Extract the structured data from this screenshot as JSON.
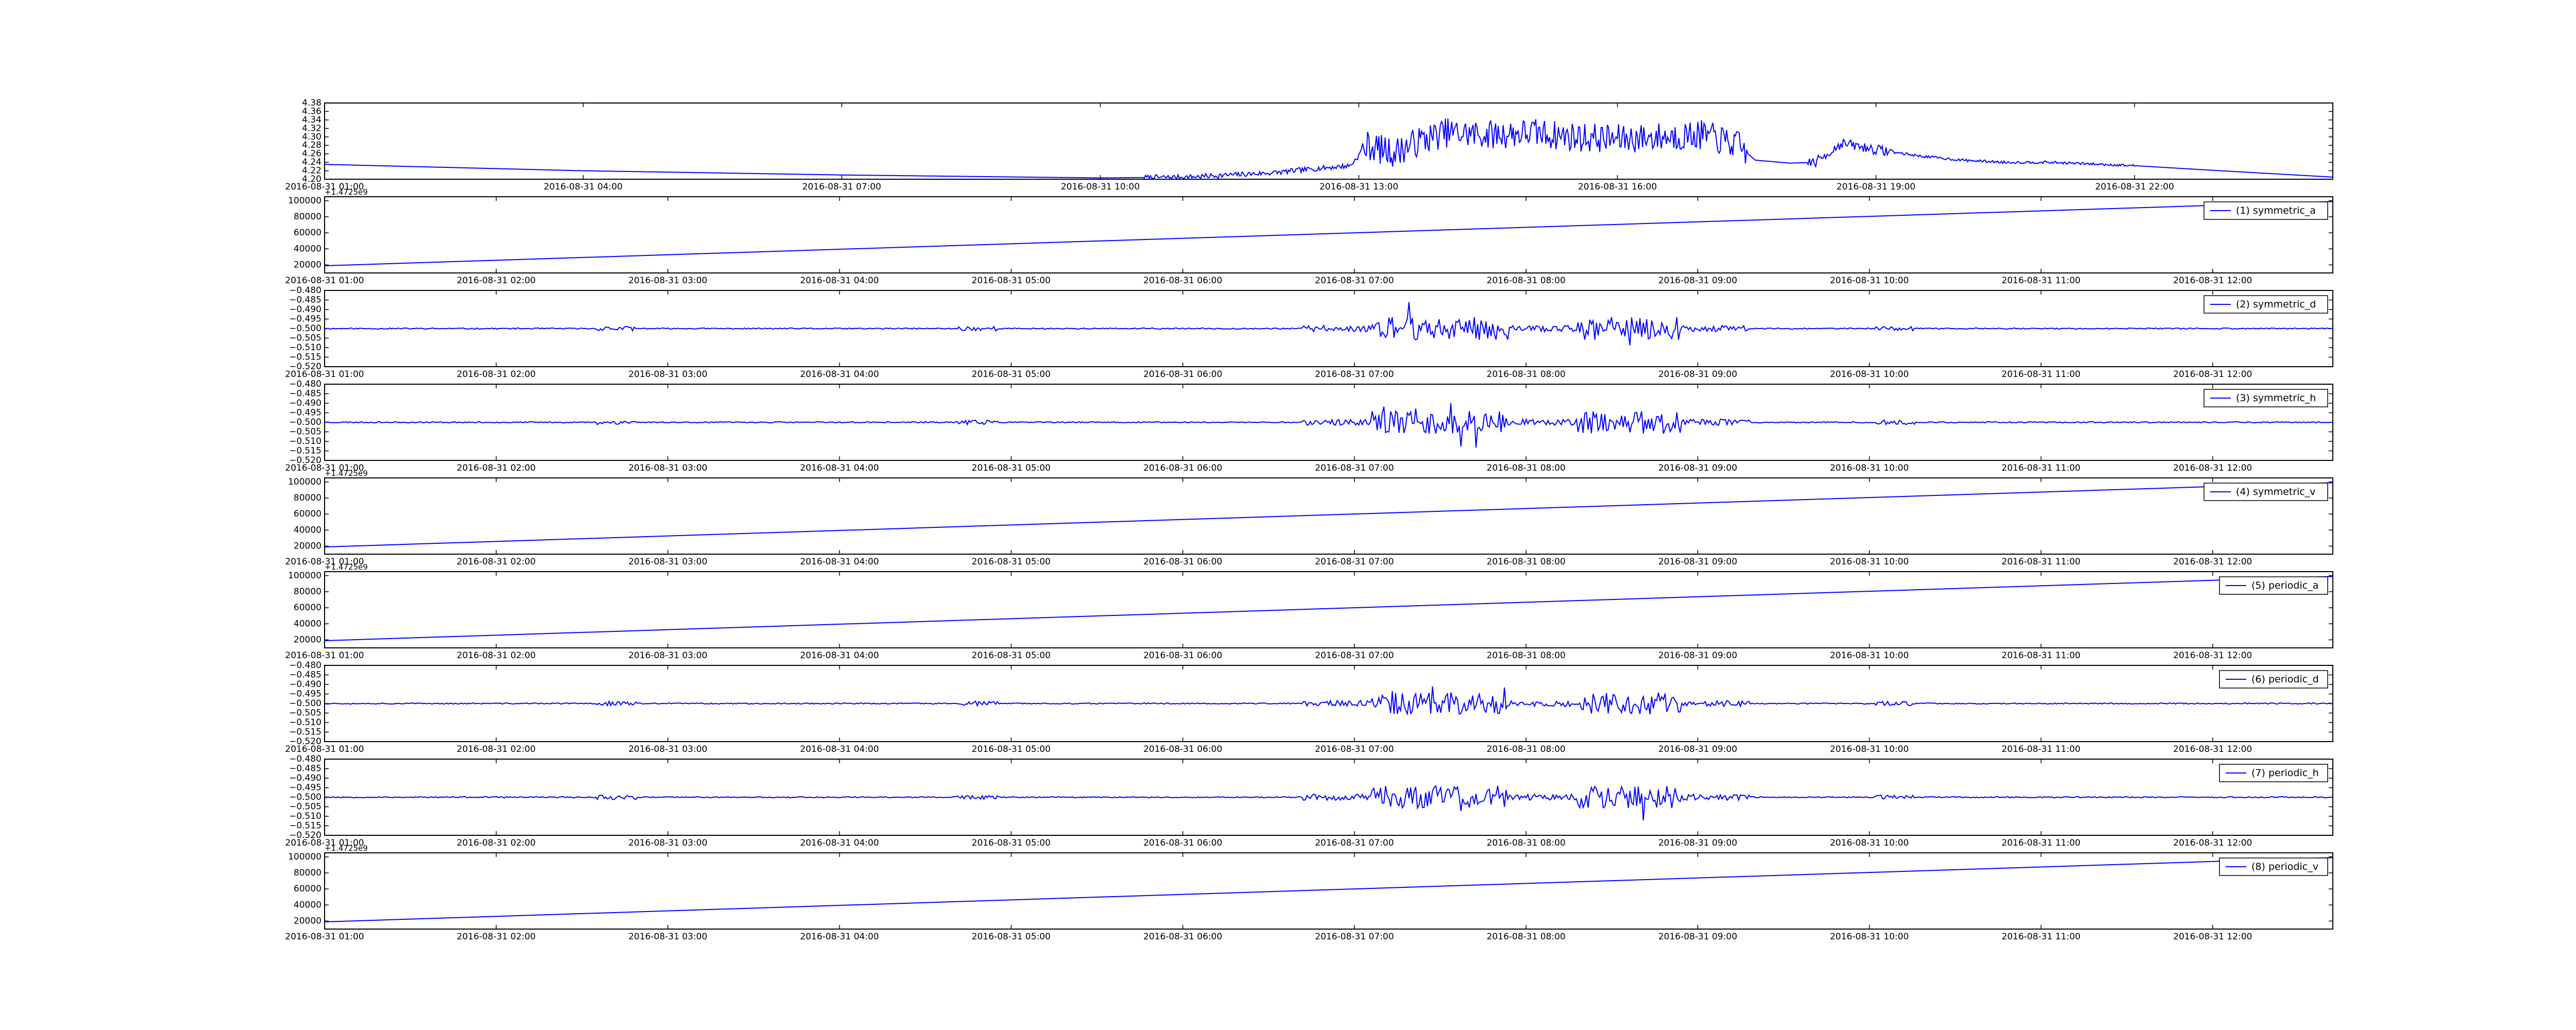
{
  "colors": {
    "line": "#0000ff",
    "axes": "#000000",
    "background": "#ffffff"
  },
  "chart_data": [
    {
      "type": "line",
      "signal": "raw",
      "x_ticks": [
        "2016-08-31 01:00",
        "2016-08-31 04:00",
        "2016-08-31 07:00",
        "2016-08-31 10:00",
        "2016-08-31 13:00",
        "2016-08-31 16:00",
        "2016-08-31 19:00",
        "2016-08-31 22:00"
      ],
      "y_ticks": [
        "4.38",
        "4.36",
        "4.34",
        "4.32",
        "4.30",
        "4.28",
        "4.26",
        "4.24",
        "4.22",
        "4.20"
      ],
      "ylim": [
        4.2,
        4.38
      ],
      "xlim_hours": [
        1,
        24.3
      ],
      "series": [
        {
          "name": "",
          "x_hours": [
            1,
            4,
            7,
            10,
            11,
            12,
            12.5,
            12.9,
            13.1,
            13.4,
            13.7,
            14,
            14.5,
            15,
            15.5,
            16,
            16.5,
            17,
            17.4,
            17.6,
            18,
            18.3,
            18.6,
            19,
            19.5,
            20,
            20.5,
            21,
            21.5,
            22,
            23,
            24.3
          ],
          "values": [
            4.235,
            4.22,
            4.21,
            4.203,
            4.205,
            4.215,
            4.225,
            4.232,
            4.28,
            4.262,
            4.29,
            4.31,
            4.305,
            4.31,
            4.3,
            4.295,
            4.3,
            4.305,
            4.28,
            4.245,
            4.238,
            4.24,
            4.285,
            4.27,
            4.255,
            4.245,
            4.24,
            4.24,
            4.236,
            4.232,
            4.22,
            4.205
          ]
        }
      ],
      "burst_hours": [
        13.0,
        17.5
      ],
      "burst_amp": 0.035,
      "small_burst": [
        18.2,
        19.2
      ]
    },
    {
      "type": "line",
      "signal": "trend",
      "x_ticks": [
        "2016-08-31 01:00",
        "2016-08-31 02:00",
        "2016-08-31 03:00",
        "2016-08-31 04:00",
        "2016-08-31 05:00",
        "2016-08-31 06:00",
        "2016-08-31 07:00",
        "2016-08-31 08:00",
        "2016-08-31 09:00",
        "2016-08-31 10:00",
        "2016-08-31 11:00",
        "2016-08-31 12:00"
      ],
      "y_ticks": [
        "100000",
        "80000",
        "60000",
        "40000",
        "20000"
      ],
      "offset": "+1.4725e9",
      "ylim": [
        10000,
        105000
      ],
      "xlim_hours": [
        1,
        12.7
      ],
      "series": [
        {
          "name": "(1) symmetric_a",
          "x_hours": [
            1,
            12.7
          ],
          "values": [
            19000,
            99000
          ]
        }
      ]
    },
    {
      "type": "line",
      "signal": "noise",
      "x_ticks": [
        "2016-08-31 01:00",
        "2016-08-31 02:00",
        "2016-08-31 03:00",
        "2016-08-31 04:00",
        "2016-08-31 05:00",
        "2016-08-31 06:00",
        "2016-08-31 07:00",
        "2016-08-31 08:00",
        "2016-08-31 09:00",
        "2016-08-31 10:00",
        "2016-08-31 11:00",
        "2016-08-31 12:00"
      ],
      "y_ticks": [
        "−0.480",
        "−0.485",
        "−0.490",
        "−0.495",
        "−0.500",
        "−0.505",
        "−0.510",
        "−0.515",
        "−0.520"
      ],
      "ylim": [
        -0.52,
        -0.48
      ],
      "baseline": -0.5,
      "xlim_hours": [
        1,
        12.7
      ],
      "series": [
        {
          "name": "(2) symmetric_d",
          "seed": 11
        }
      ]
    },
    {
      "type": "line",
      "signal": "noise",
      "x_ticks": [
        "2016-08-31 01:00",
        "2016-08-31 02:00",
        "2016-08-31 03:00",
        "2016-08-31 04:00",
        "2016-08-31 05:00",
        "2016-08-31 06:00",
        "2016-08-31 07:00",
        "2016-08-31 08:00",
        "2016-08-31 09:00",
        "2016-08-31 10:00",
        "2016-08-31 11:00",
        "2016-08-31 12:00"
      ],
      "y_ticks": [
        "−0.480",
        "−0.485",
        "−0.490",
        "−0.495",
        "−0.500",
        "−0.505",
        "−0.510",
        "−0.515",
        "−0.520"
      ],
      "ylim": [
        -0.52,
        -0.48
      ],
      "baseline": -0.5,
      "xlim_hours": [
        1,
        12.7
      ],
      "series": [
        {
          "name": "(3) symmetric_h",
          "seed": 23
        }
      ]
    },
    {
      "type": "line",
      "signal": "trend",
      "x_ticks": [
        "2016-08-31 01:00",
        "2016-08-31 02:00",
        "2016-08-31 03:00",
        "2016-08-31 04:00",
        "2016-08-31 05:00",
        "2016-08-31 06:00",
        "2016-08-31 07:00",
        "2016-08-31 08:00",
        "2016-08-31 09:00",
        "2016-08-31 10:00",
        "2016-08-31 11:00",
        "2016-08-31 12:00"
      ],
      "y_ticks": [
        "100000",
        "80000",
        "60000",
        "40000",
        "20000"
      ],
      "offset": "+1.4725e9",
      "ylim": [
        10000,
        105000
      ],
      "xlim_hours": [
        1,
        12.7
      ],
      "series": [
        {
          "name": "(4) symmetric_v",
          "x_hours": [
            1,
            12.7
          ],
          "values": [
            19000,
            99000
          ]
        }
      ]
    },
    {
      "type": "line",
      "signal": "trend",
      "x_ticks": [
        "2016-08-31 01:00",
        "2016-08-31 02:00",
        "2016-08-31 03:00",
        "2016-08-31 04:00",
        "2016-08-31 05:00",
        "2016-08-31 06:00",
        "2016-08-31 07:00",
        "2016-08-31 08:00",
        "2016-08-31 09:00",
        "2016-08-31 10:00",
        "2016-08-31 11:00",
        "2016-08-31 12:00"
      ],
      "y_ticks": [
        "100000",
        "80000",
        "60000",
        "40000",
        "20000"
      ],
      "offset": "+1.4725e9",
      "ylim": [
        10000,
        105000
      ],
      "xlim_hours": [
        1,
        12.7
      ],
      "series": [
        {
          "name": "(5) periodic_a",
          "x_hours": [
            1,
            12.7
          ],
          "values": [
            19000,
            99000
          ]
        }
      ]
    },
    {
      "type": "line",
      "signal": "noise",
      "x_ticks": [
        "2016-08-31 01:00",
        "2016-08-31 02:00",
        "2016-08-31 03:00",
        "2016-08-31 04:00",
        "2016-08-31 05:00",
        "2016-08-31 06:00",
        "2016-08-31 07:00",
        "2016-08-31 08:00",
        "2016-08-31 09:00",
        "2016-08-31 10:00",
        "2016-08-31 11:00",
        "2016-08-31 12:00"
      ],
      "y_ticks": [
        "−0.480",
        "−0.485",
        "−0.490",
        "−0.495",
        "−0.500",
        "−0.505",
        "−0.510",
        "−0.515",
        "−0.520"
      ],
      "ylim": [
        -0.52,
        -0.48
      ],
      "baseline": -0.5,
      "xlim_hours": [
        1,
        12.7
      ],
      "series": [
        {
          "name": "(6) periodic_d",
          "seed": 37
        }
      ]
    },
    {
      "type": "line",
      "signal": "noise",
      "x_ticks": [
        "2016-08-31 01:00",
        "2016-08-31 02:00",
        "2016-08-31 03:00",
        "2016-08-31 04:00",
        "2016-08-31 05:00",
        "2016-08-31 06:00",
        "2016-08-31 07:00",
        "2016-08-31 08:00",
        "2016-08-31 09:00",
        "2016-08-31 10:00",
        "2016-08-31 11:00",
        "2016-08-31 12:00"
      ],
      "y_ticks": [
        "−0.480",
        "−0.485",
        "−0.490",
        "−0.495",
        "−0.500",
        "−0.505",
        "−0.510",
        "−0.515",
        "−0.520"
      ],
      "ylim": [
        -0.52,
        -0.48
      ],
      "baseline": -0.5,
      "xlim_hours": [
        1,
        12.7
      ],
      "series": [
        {
          "name": "(7) periodic_h",
          "seed": 53
        }
      ]
    },
    {
      "type": "line",
      "signal": "trend",
      "x_ticks": [
        "2016-08-31 01:00",
        "2016-08-31 02:00",
        "2016-08-31 03:00",
        "2016-08-31 04:00",
        "2016-08-31 05:00",
        "2016-08-31 06:00",
        "2016-08-31 07:00",
        "2016-08-31 08:00",
        "2016-08-31 09:00",
        "2016-08-31 10:00",
        "2016-08-31 11:00",
        "2016-08-31 12:00"
      ],
      "y_ticks": [
        "100000",
        "80000",
        "60000",
        "40000",
        "20000"
      ],
      "offset": "+1.4725e9",
      "ylim": [
        10000,
        105000
      ],
      "xlim_hours": [
        1,
        12.7
      ],
      "series": [
        {
          "name": "(8) periodic_v",
          "x_hours": [
            1,
            12.7
          ],
          "values": [
            19000,
            99000
          ]
        }
      ]
    }
  ]
}
